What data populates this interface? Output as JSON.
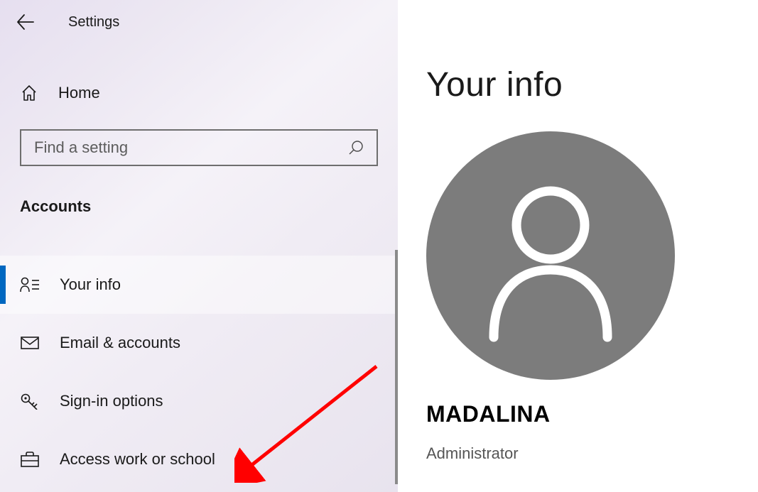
{
  "header": {
    "title": "Settings"
  },
  "sidebar": {
    "home_label": "Home",
    "search_placeholder": "Find a setting",
    "section": "Accounts",
    "items": [
      {
        "label": "Your info"
      },
      {
        "label": "Email & accounts"
      },
      {
        "label": "Sign-in options"
      },
      {
        "label": "Access work or school"
      }
    ]
  },
  "main": {
    "page_title": "Your info",
    "user_name": "MADALINA",
    "user_role": "Administrator"
  }
}
